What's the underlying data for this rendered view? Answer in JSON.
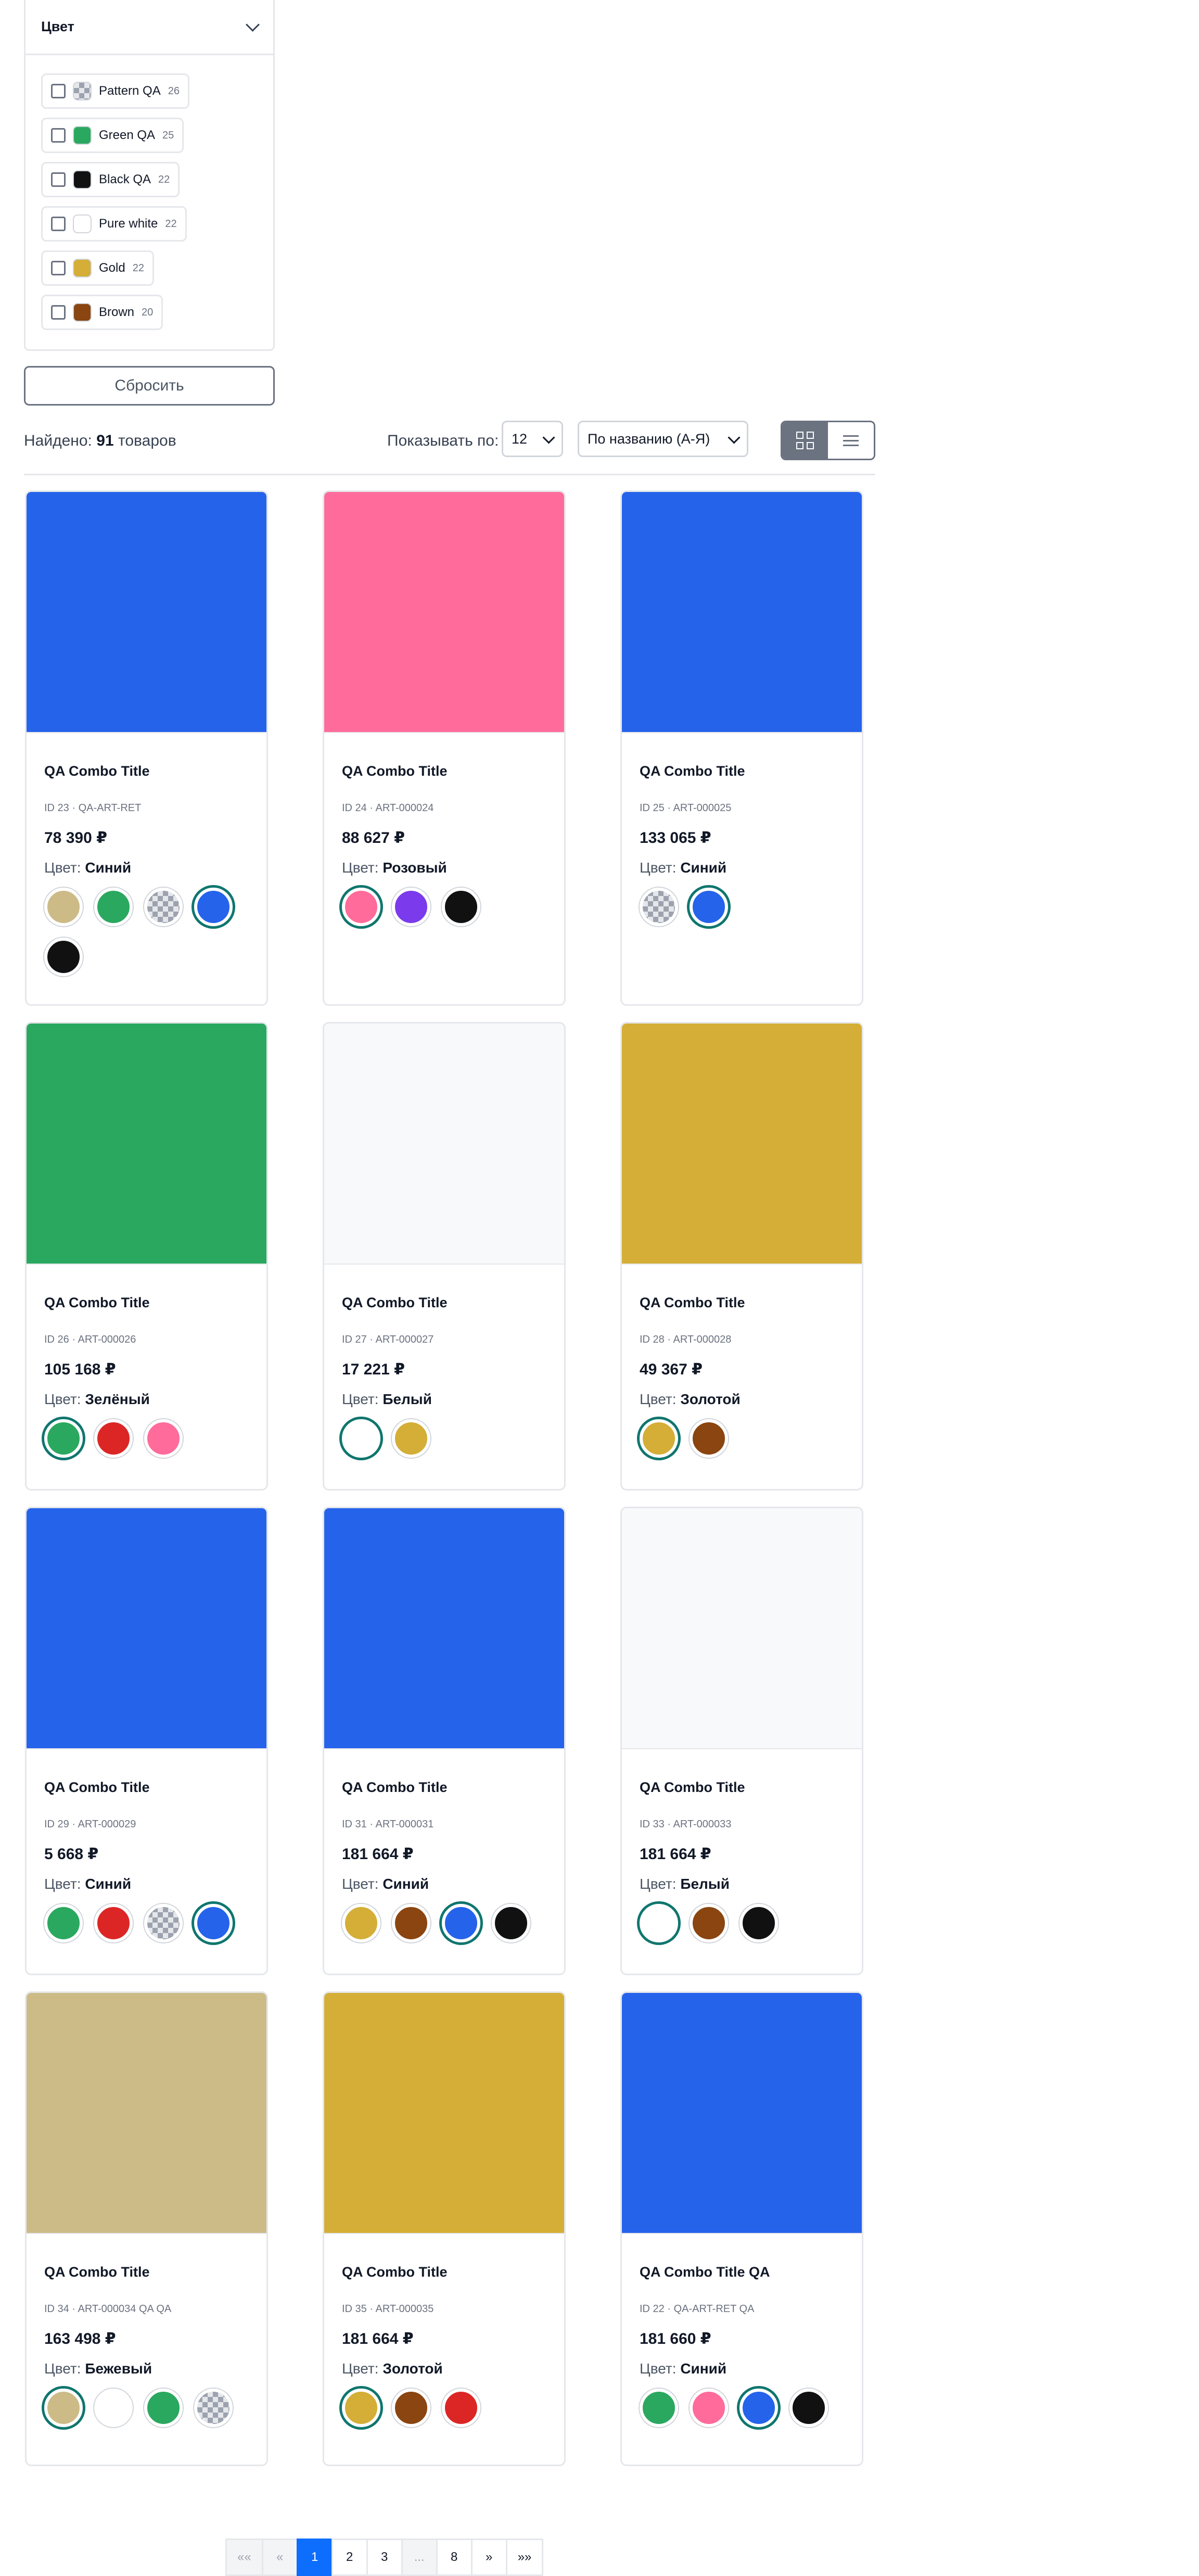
{
  "filter": {
    "title": "Цвет",
    "items": [
      {
        "label": "Pattern QA",
        "count": "26",
        "color": "pattern"
      },
      {
        "label": "Green QA",
        "count": "25",
        "color": "#2aa85f"
      },
      {
        "label": "Black QA",
        "count": "22",
        "color": "#111111"
      },
      {
        "label": "Pure white",
        "count": "22",
        "color": "#ffffff"
      },
      {
        "label": "Gold",
        "count": "22",
        "color": "#d4ae36"
      },
      {
        "label": "Brown",
        "count": "20",
        "color": "#8a4510"
      }
    ],
    "reset_label": "Сбросить"
  },
  "toolbar": {
    "found_prefix": "Найдено:",
    "found_count": "91",
    "found_suffix": "товаров",
    "per_page_label": "Показывать по:",
    "per_page_value": "12",
    "sort_value": "По названию (А-Я)"
  },
  "products": [
    {
      "title": "QA Combo Title",
      "id": "ID 23 · QA-ART-RET",
      "price": "78 390 ₽",
      "color_label": "Цвет:",
      "color_name": "Синий",
      "image_color": "#2563eb",
      "swatches": [
        {
          "c": "#cdbb87"
        },
        {
          "c": "#2aa85f"
        },
        {
          "c": "pattern"
        },
        {
          "c": "#2563eb",
          "selected": true
        },
        {
          "c": "#111111"
        }
      ]
    },
    {
      "title": "QA Combo Title",
      "id": "ID 24 · ART-000024",
      "price": "88 627 ₽",
      "color_label": "Цвет:",
      "color_name": "Розовый",
      "image_color": "#ff6b9b",
      "swatches": [
        {
          "c": "#ff6b9b",
          "selected": true
        },
        {
          "c": "#7c3aed"
        },
        {
          "c": "#111111"
        }
      ]
    },
    {
      "title": "QA Combo Title",
      "id": "ID 25 · ART-000025",
      "price": "133 065 ₽",
      "color_label": "Цвет:",
      "color_name": "Синий",
      "image_color": "#2563eb",
      "swatches": [
        {
          "c": "pattern"
        },
        {
          "c": "#2563eb",
          "selected": true
        }
      ]
    },
    {
      "title": "QA Combo Title",
      "id": "ID 26 · ART-000026",
      "price": "105 168 ₽",
      "color_label": "Цвет:",
      "color_name": "Зелёный",
      "image_color": "#2aa85f",
      "swatches": [
        {
          "c": "#2aa85f",
          "selected": true
        },
        {
          "c": "#dc2626"
        },
        {
          "c": "#ff6b9b"
        }
      ]
    },
    {
      "title": "QA Combo Title",
      "id": "ID 27 · ART-000027",
      "price": "17 221 ₽",
      "color_label": "Цвет:",
      "color_name": "Белый",
      "image_color": "#f8f9fb",
      "swatches": [
        {
          "c": "#ffffff",
          "selected": true
        },
        {
          "c": "#d4ae36"
        }
      ]
    },
    {
      "title": "QA Combo Title",
      "id": "ID 28 · ART-000028",
      "price": "49 367 ₽",
      "color_label": "Цвет:",
      "color_name": "Золотой",
      "image_color": "#d4ae36",
      "swatches": [
        {
          "c": "#d4ae36",
          "selected": true
        },
        {
          "c": "#8a4510"
        }
      ]
    },
    {
      "title": "QA Combo Title",
      "id": "ID 29 · ART-000029",
      "price": "5 668 ₽",
      "color_label": "Цвет:",
      "color_name": "Синий",
      "image_color": "#2563eb",
      "swatches": [
        {
          "c": "#2aa85f"
        },
        {
          "c": "#dc2626"
        },
        {
          "c": "pattern"
        },
        {
          "c": "#2563eb",
          "selected": true
        }
      ]
    },
    {
      "title": "QA Combo Title",
      "id": "ID 31 · ART-000031",
      "price": "181 664 ₽",
      "color_label": "Цвет:",
      "color_name": "Синий",
      "image_color": "#2563eb",
      "swatches": [
        {
          "c": "#d4ae36"
        },
        {
          "c": "#8a4510"
        },
        {
          "c": "#2563eb",
          "selected": true
        },
        {
          "c": "#111111"
        }
      ]
    },
    {
      "title": "QA Combo Title",
      "id": "ID 33 · ART-000033",
      "price": "181 664 ₽",
      "color_label": "Цвет:",
      "color_name": "Белый",
      "image_color": "#f8f9fb",
      "swatches": [
        {
          "c": "#ffffff",
          "selected": true
        },
        {
          "c": "#8a4510"
        },
        {
          "c": "#111111"
        }
      ]
    },
    {
      "title": "QA Combo Title",
      "id": "ID 34 · ART-000034 QA QA",
      "price": "163 498 ₽",
      "color_label": "Цвет:",
      "color_name": "Бежевый",
      "image_color": "#cdbb87",
      "swatches": [
        {
          "c": "#cdbb87",
          "selected": true
        },
        {
          "c": "#ffffff"
        },
        {
          "c": "#2aa85f"
        },
        {
          "c": "pattern"
        }
      ]
    },
    {
      "title": "QA Combo Title",
      "id": "ID 35 · ART-000035",
      "price": "181 664 ₽",
      "color_label": "Цвет:",
      "color_name": "Золотой",
      "image_color": "#d4ae36",
      "swatches": [
        {
          "c": "#d4ae36",
          "selected": true
        },
        {
          "c": "#8a4510"
        },
        {
          "c": "#dc2626"
        }
      ]
    },
    {
      "title": "QA Combo Title QA",
      "id": "ID 22 · QA-ART-RET QA",
      "price": "181 660 ₽",
      "color_label": "Цвет:",
      "color_name": "Синий",
      "image_color": "#2563eb",
      "swatches": [
        {
          "c": "#2aa85f"
        },
        {
          "c": "#ff6b9b"
        },
        {
          "c": "#2563eb",
          "selected": true
        },
        {
          "c": "#111111"
        }
      ]
    }
  ],
  "pagination": {
    "first": "««",
    "prev": "«",
    "pages": [
      "1",
      "2",
      "3"
    ],
    "ellipsis": "...",
    "last_page": "8",
    "next": "»",
    "last": "»»"
  }
}
